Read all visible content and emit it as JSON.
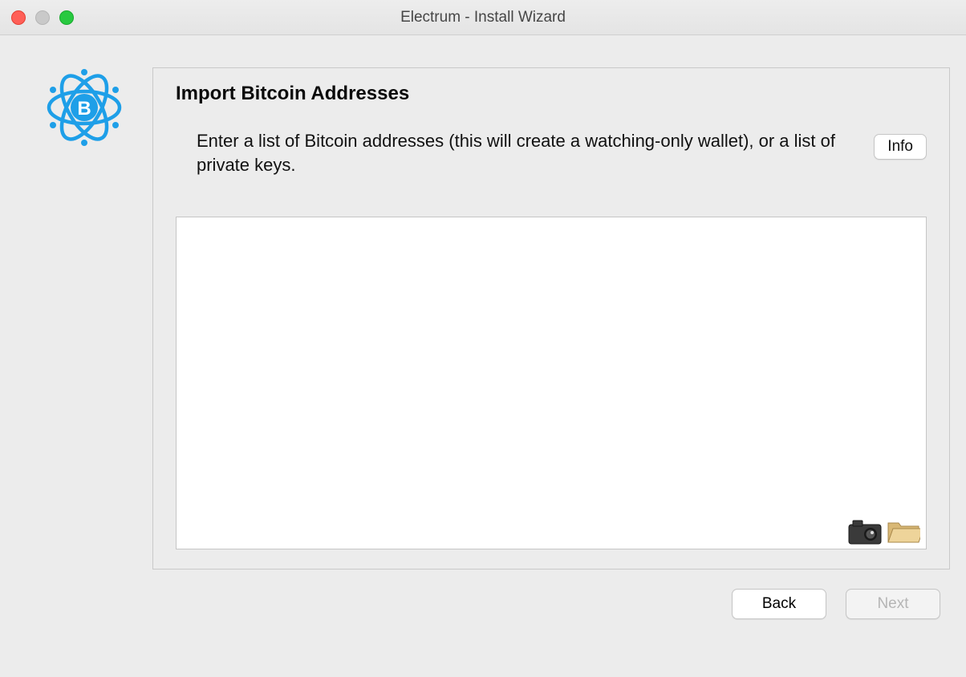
{
  "window": {
    "title": "Electrum  -  Install Wizard"
  },
  "panel": {
    "heading": "Import Bitcoin Addresses",
    "instruction": "Enter a list of Bitcoin addresses (this will create a watching-only wallet), or a list of private keys.",
    "info_label": "Info",
    "textarea_value": ""
  },
  "footer": {
    "back_label": "Back",
    "next_label": "Next",
    "next_enabled": false
  },
  "icons": {
    "camera": "camera-icon",
    "folder": "folder-icon"
  }
}
